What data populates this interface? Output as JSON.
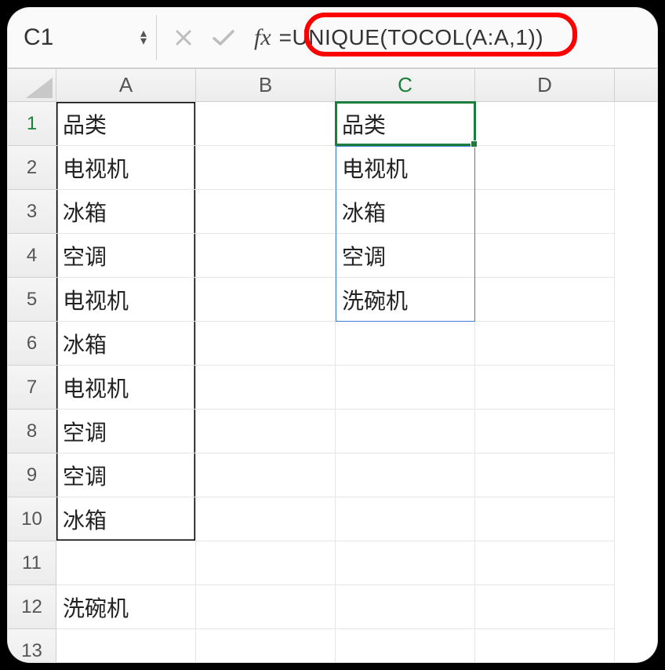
{
  "formula_bar": {
    "cell_ref": "C1",
    "formula": "=UNIQUE(TOCOL(A:A,1))"
  },
  "columns": [
    "A",
    "B",
    "C",
    "D"
  ],
  "row_numbers": [
    "1",
    "2",
    "3",
    "4",
    "5",
    "6",
    "7",
    "8",
    "9",
    "10",
    "11",
    "12",
    "13"
  ],
  "colA": {
    "r1": "品类",
    "r2": "电视机",
    "r3": "冰箱",
    "r4": "空调",
    "r5": "电视机",
    "r6": "冰箱",
    "r7": "电视机",
    "r8": "空调",
    "r9": "空调",
    "r10": "冰箱",
    "r11": "",
    "r12": "洗碗机",
    "r13": ""
  },
  "colC": {
    "r1": "品类",
    "r2": "电视机",
    "r3": "冰箱",
    "r4": "空调",
    "r5": "洗碗机"
  },
  "active_cell": "C1",
  "selection": {
    "col": "C",
    "row": 1
  },
  "spill": {
    "start": "C2",
    "end": "C5"
  }
}
